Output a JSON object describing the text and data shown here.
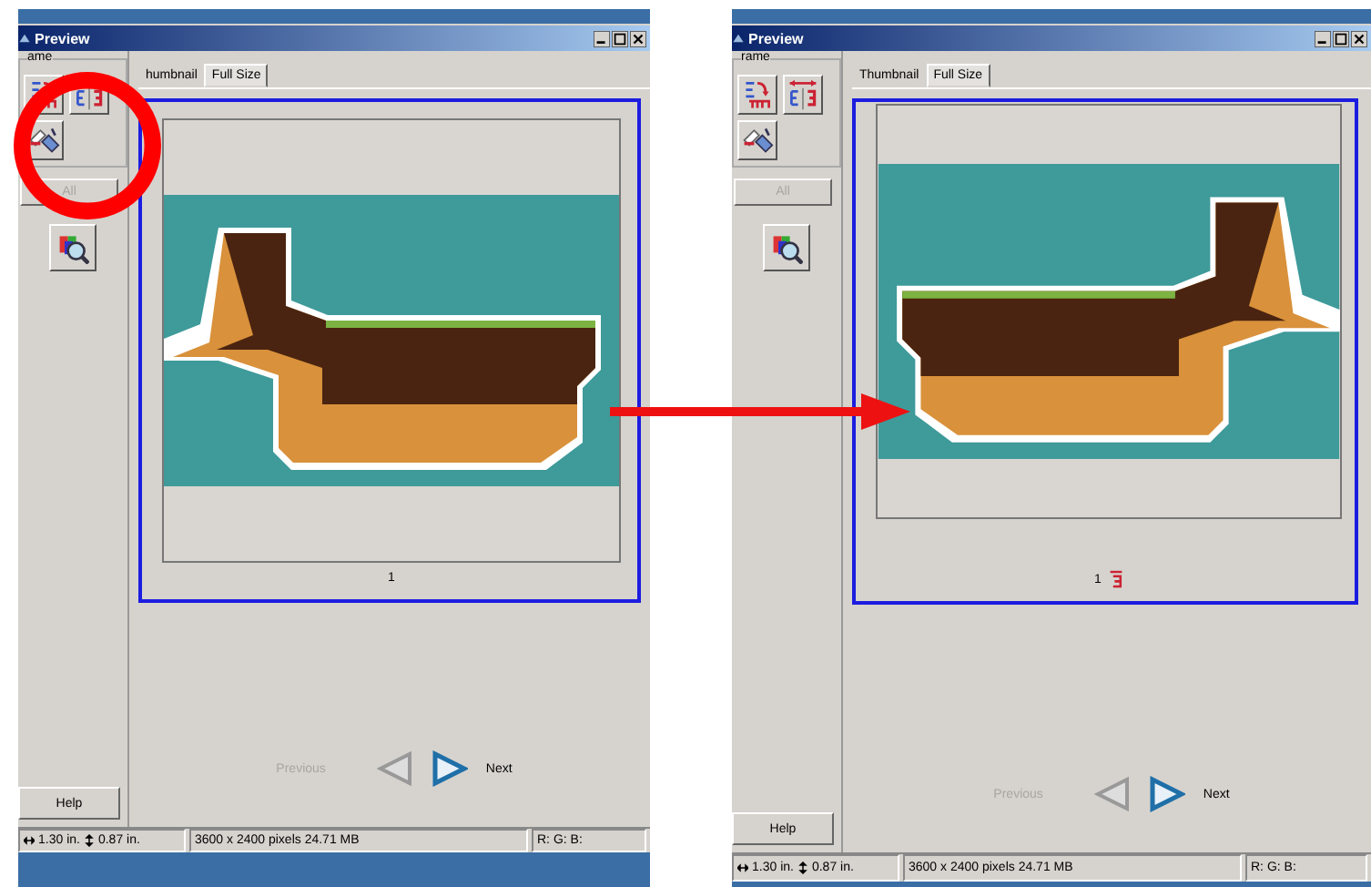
{
  "windows": [
    {
      "title": "Preview",
      "tabs": [
        {
          "label": "humbnail",
          "selected": false
        },
        {
          "label": "Full Size",
          "selected": true
        }
      ],
      "frame_label": "ame",
      "all_button": {
        "label": "All",
        "disabled": true
      },
      "help_button": "Help",
      "page_number": "1",
      "mirrored": false,
      "nav": {
        "previous": {
          "label": "Previous",
          "disabled": true
        },
        "next": {
          "label": "Next",
          "disabled": false
        }
      },
      "status": {
        "width": "1.30 in.",
        "height": "0.87 in.",
        "size": "3600 x 2400 pixels 24.71 MB",
        "rgb_readout": "R: G: B:"
      }
    },
    {
      "title": "Preview",
      "tabs": [
        {
          "label": "Thumbnail",
          "selected": false
        },
        {
          "label": "Full Size",
          "selected": true
        }
      ],
      "frame_label": "rame",
      "all_button": {
        "label": "All",
        "disabled": true
      },
      "help_button": "Help",
      "page_number": "1",
      "mirrored": true,
      "nav": {
        "previous": {
          "label": "Previous",
          "disabled": true
        },
        "next": {
          "label": "Next",
          "disabled": false
        }
      },
      "status": {
        "width": "1.30 in.",
        "height": "0.87 in.",
        "size": "3600 x 2400 pixels 24.71 MB",
        "rgb_readout": "R: G: B:"
      }
    }
  ]
}
